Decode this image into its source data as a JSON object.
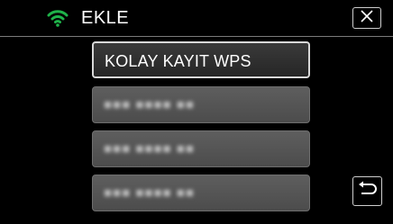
{
  "header": {
    "title": "EKLE",
    "wifi_icon": "wifi-icon",
    "close_icon": "close-icon",
    "wifi_color": "#1fb34a"
  },
  "list": {
    "items": [
      {
        "label": "KOLAY KAYIT WPS",
        "selected": true
      },
      {
        "label": "■■■ ■■■■ ■■",
        "selected": false
      },
      {
        "label": "■■■ ■■■■ ■■",
        "selected": false
      },
      {
        "label": "■■■ ■■■■ ■■",
        "selected": false
      }
    ]
  },
  "footer": {
    "back_icon": "return-icon"
  }
}
